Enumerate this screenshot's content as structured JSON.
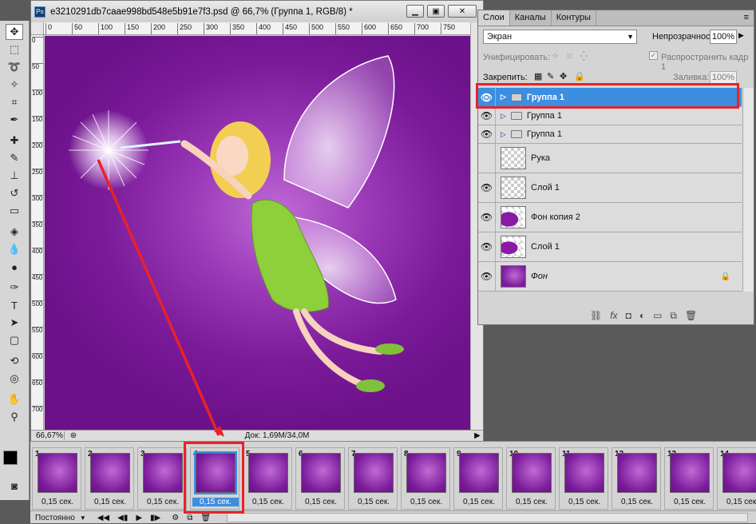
{
  "document": {
    "title": "e3210291db7caae998bd548e5b91e7f3.psd @ 66,7% (Группа 1, RGB/8) *",
    "app_badge": "Ps",
    "zoom": "66,67%",
    "doc_info": "Док: 1,69M/34,0M"
  },
  "ruler": {
    "top_ticks": [
      "0",
      "50",
      "100",
      "150",
      "200",
      "250",
      "300",
      "350",
      "400",
      "450",
      "500",
      "550",
      "600",
      "650",
      "700",
      "750"
    ],
    "left_ticks": [
      "0",
      "50",
      "100",
      "150",
      "200",
      "250",
      "300",
      "350",
      "400",
      "450",
      "500",
      "550",
      "600",
      "650",
      "700"
    ]
  },
  "layers_panel": {
    "tabs": [
      "Слои",
      "Каналы",
      "Контуры"
    ],
    "blend_mode": "Экран",
    "opacity_label": "Непрозрачность:",
    "opacity_value": "100%",
    "unify_label": "Унифицировать:",
    "propagate_label": "Распространить кадр 1",
    "lock_label": "Закрепить:",
    "fill_label": "Заливка:",
    "fill_value": "100%",
    "layers": [
      {
        "name": "Группа 1",
        "type": "group",
        "visible": true,
        "selected": true
      },
      {
        "name": "Группа 1",
        "type": "group",
        "visible": true,
        "selected": false
      },
      {
        "name": "Группа 1",
        "type": "group",
        "visible": true,
        "selected": false
      },
      {
        "name": "Рука",
        "type": "layer",
        "visible": false,
        "selected": false
      },
      {
        "name": "Слой 1",
        "type": "layer",
        "visible": true,
        "selected": false
      },
      {
        "name": "Фон копия 2",
        "type": "layer",
        "visible": true,
        "selected": false
      },
      {
        "name": "Слой 1",
        "type": "layer",
        "visible": true,
        "selected": false
      },
      {
        "name": "Фон",
        "type": "background",
        "visible": true,
        "selected": false,
        "locked": true
      }
    ]
  },
  "timeline": {
    "loop_option": "Постоянно",
    "frames": [
      {
        "num": "1",
        "delay": "0,15 сек."
      },
      {
        "num": "2",
        "delay": "0,15 сек."
      },
      {
        "num": "3",
        "delay": "0,15 сек."
      },
      {
        "num": "4",
        "delay": "0,15 сек.",
        "selected": true
      },
      {
        "num": "5",
        "delay": "0,15 сек."
      },
      {
        "num": "6",
        "delay": "0,15 сек."
      },
      {
        "num": "7",
        "delay": "0,15 сек."
      },
      {
        "num": "8",
        "delay": "0,15 сек."
      },
      {
        "num": "9",
        "delay": "0,15 сек."
      },
      {
        "num": "10",
        "delay": "0,15 сек."
      },
      {
        "num": "11",
        "delay": "0,15 сек."
      },
      {
        "num": "12",
        "delay": "0,15 сек."
      },
      {
        "num": "13",
        "delay": "0,15 сек."
      },
      {
        "num": "14",
        "delay": "0,15 сек."
      }
    ]
  },
  "colors": {
    "canvas_bg": "#7a1a99",
    "selection": "#3b8ee0",
    "annotation_red": "#e8222a"
  }
}
